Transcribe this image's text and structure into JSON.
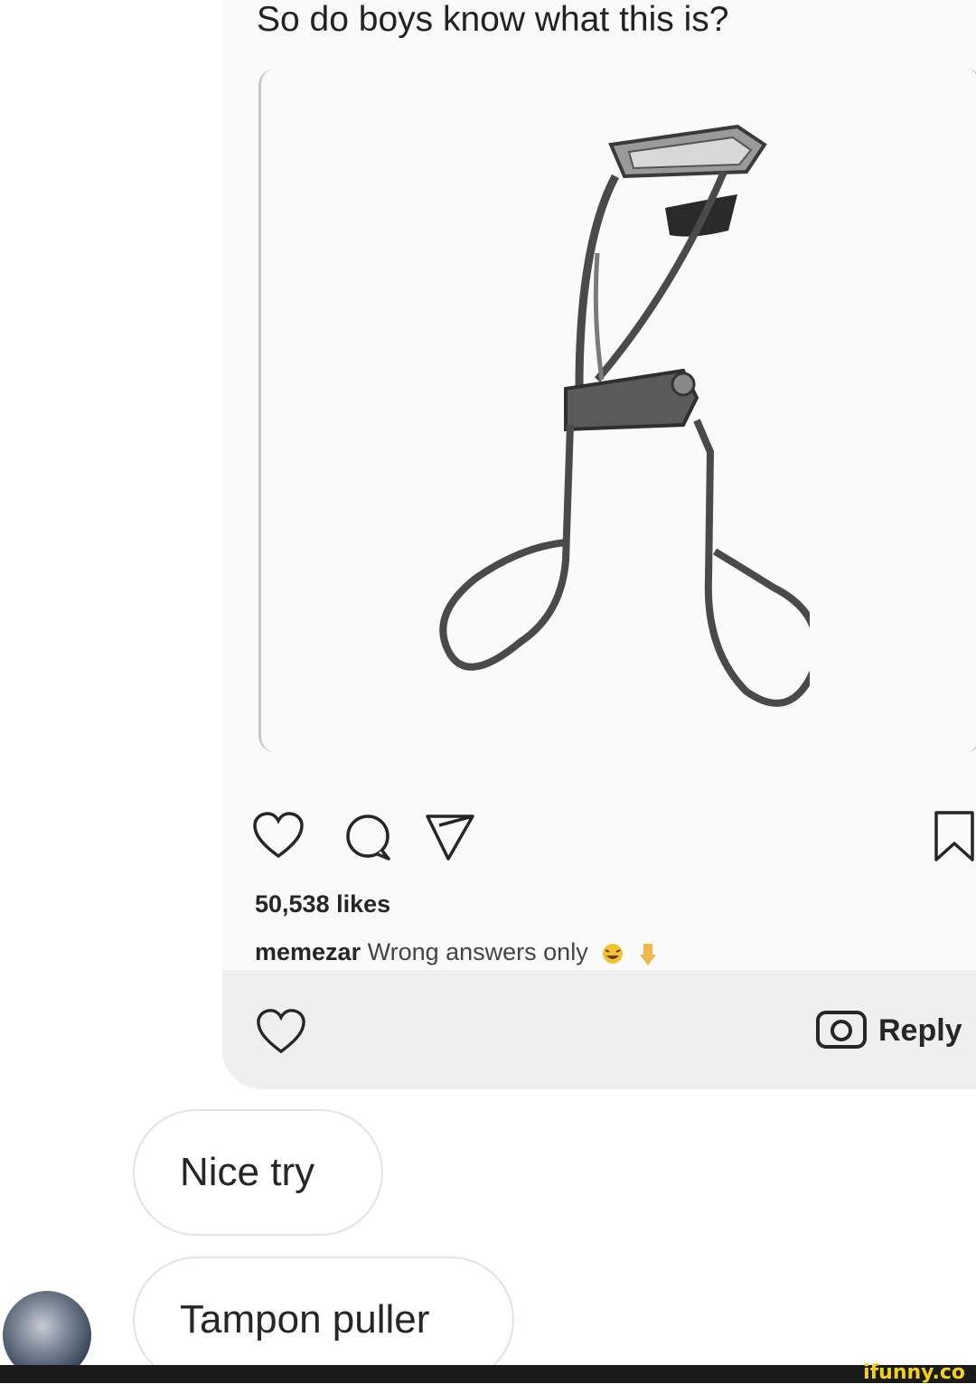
{
  "post": {
    "top_caption": "So do boys know what this is?",
    "likes": "50,538 likes",
    "caption_user": "memezar",
    "caption_text": "Wrong answers only"
  },
  "reply_bar": {
    "reply_label": "Reply"
  },
  "messages": [
    {
      "text": "Nice try"
    },
    {
      "text": "Tampon puller"
    }
  ],
  "watermark": "ifunny.co",
  "icons": {
    "like": "heart-icon",
    "comment": "comment-icon",
    "share": "send-icon",
    "save": "bookmark-icon",
    "camera": "camera-icon"
  }
}
